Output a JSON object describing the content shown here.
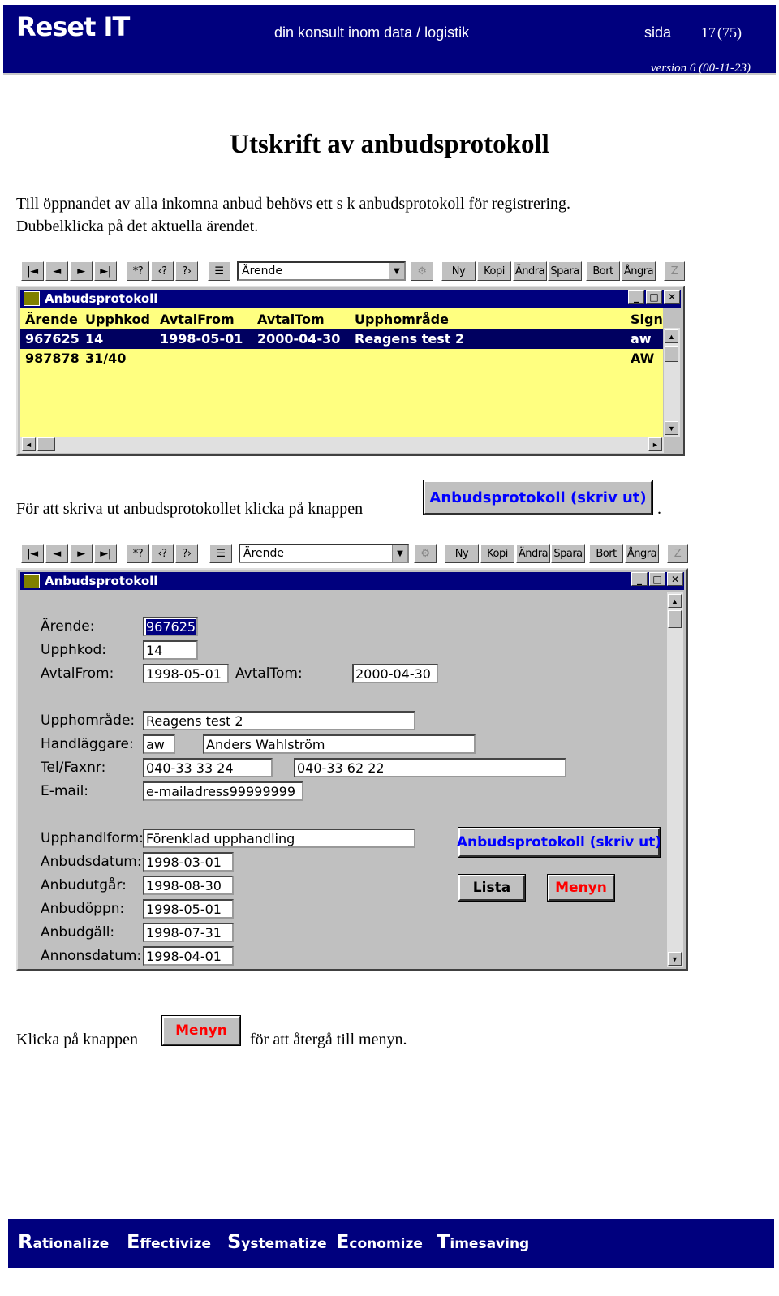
{
  "header": {
    "logo": "Reset IT",
    "tagline": "din konsult inom data / logistik",
    "page_label": "sida",
    "page_number": "17",
    "page_total": "(75)",
    "version": "version 6 (00-11-23)"
  },
  "title": "Utskrift av anbudsprotokoll",
  "intro_line1": "Till öppnandet av alla inkomna anbud behövs ett s k anbudsprotokoll för registrering.",
  "intro_line2": "Dubbelklicka på det aktuella ärendet.",
  "toolbar": {
    "nav": [
      "|◄",
      "◄",
      "►",
      "►|"
    ],
    "query": [
      "*?",
      "‹?",
      "?›"
    ],
    "combo_value": "Ärende",
    "actions": [
      "Ny",
      "Kopi",
      "Ändra",
      "Spara",
      "Bort",
      "Ångra"
    ],
    "z": "Z"
  },
  "list_window": {
    "title": "Anbudsprotokoll",
    "columns": [
      "Ärende",
      "Upphkod",
      "AvtalFrom",
      "AvtalTom",
      "Upphområde",
      "Sign"
    ],
    "rows": [
      [
        "967625",
        "14",
        "1998-05-01",
        "2000-04-30",
        "Reagens test 2",
        "aw"
      ],
      [
        "987878",
        "31/40",
        "",
        "",
        "",
        "AW"
      ]
    ]
  },
  "mid_text_before": "För att skriva ut anbudsprotokollet klicka på knappen",
  "mid_text_after": ".",
  "print_button_label": "Anbudsprotokoll (skriv ut)",
  "form_window": {
    "title": "Anbudsprotokoll",
    "labels": {
      "arende": "Ärende:",
      "upphkod": "Upphkod:",
      "avtalfrom": "AvtalFrom:",
      "avtaltom": "AvtalTom:",
      "upphomrade": "Upphområde:",
      "handlaggare": "Handläggare:",
      "telfax": "Tel/Faxnr:",
      "email": "E-mail:",
      "upphandlform": "Upphandlform:",
      "anbudsdatum": "Anbudsdatum:",
      "anbudutgar": "Anbudutgår:",
      "anbudoppn": "Anbudöppn:",
      "anbudgall": "Anbudgäll:",
      "annonsdatum": "Annonsdatum:"
    },
    "values": {
      "arende": "967625",
      "upphkod": "14",
      "avtalfrom": "1998-05-01",
      "avtaltom": "2000-04-30",
      "upphomrade": "Reagens test 2",
      "handlaggare_sign": "aw",
      "handlaggare_name": "Anders Wahlström",
      "tel": "040-33 33 24",
      "fax": "040-33 62 22",
      "email": "e-mailadress99999999",
      "upphandlform": "Förenklad upphandling",
      "anbudsdatum": "1998-03-01",
      "anbudutgar": "1998-08-30",
      "anbudoppn": "1998-05-01",
      "anbudgall": "1998-07-31",
      "annonsdatum": "1998-04-01"
    },
    "print_button": "Anbudsprotokoll (skriv ut)",
    "lista_button": "Lista",
    "menyn_button": "Menyn"
  },
  "bottom_before": "Klicka på knappen",
  "bottom_button": "Menyn",
  "bottom_after": "för att återgå till menyn.",
  "footer": [
    {
      "initial": "R",
      "rest": "ationalize"
    },
    {
      "initial": "E",
      "rest": "ffectivize"
    },
    {
      "initial": "S",
      "rest": "ystematize"
    },
    {
      "initial": "E",
      "rest": "conomize"
    },
    {
      "initial": "T",
      "rest": "imesaving"
    }
  ],
  "colors": {
    "header_bg": "#00007e",
    "list_bg": "#ffff80",
    "button_text_blue": "#0000ff",
    "button_text_red": "#ff0000"
  }
}
